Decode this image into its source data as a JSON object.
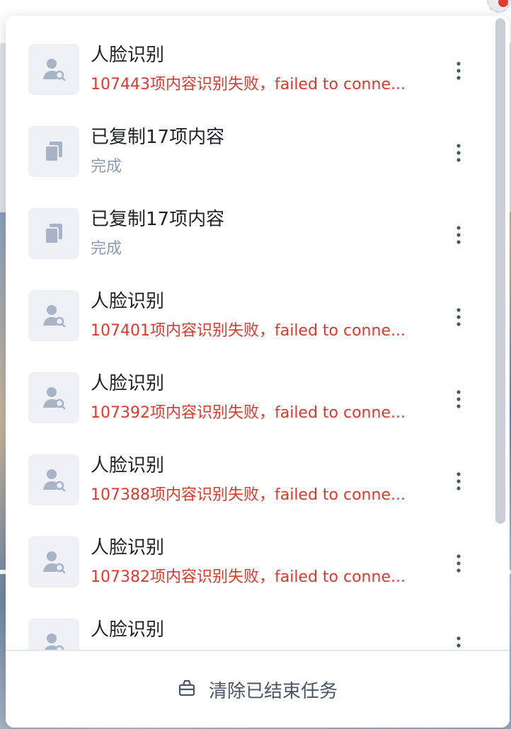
{
  "tasks": [
    {
      "type": "face",
      "icon": "face-search-icon",
      "title": "人脸识别",
      "subtitle": "107443项内容识别失败，failed to conne...",
      "status": "error"
    },
    {
      "type": "copy",
      "icon": "copy-icon",
      "title": "已复制17项内容",
      "subtitle": "完成",
      "status": "done"
    },
    {
      "type": "copy",
      "icon": "copy-icon",
      "title": "已复制17项内容",
      "subtitle": "完成",
      "status": "done"
    },
    {
      "type": "face",
      "icon": "face-search-icon",
      "title": "人脸识别",
      "subtitle": "107401项内容识别失败，failed to conne...",
      "status": "error"
    },
    {
      "type": "face",
      "icon": "face-search-icon",
      "title": "人脸识别",
      "subtitle": "107392项内容识别失败，failed to conne...",
      "status": "error"
    },
    {
      "type": "face",
      "icon": "face-search-icon",
      "title": "人脸识别",
      "subtitle": "107388项内容识别失败，failed to conne...",
      "status": "error"
    },
    {
      "type": "face",
      "icon": "face-search-icon",
      "title": "人脸识别",
      "subtitle": "107382项内容识别失败，failed to conne...",
      "status": "error"
    },
    {
      "type": "face",
      "icon": "face-search-icon",
      "title": "人脸识别",
      "subtitle": "",
      "status": "error"
    }
  ],
  "footer": {
    "clear_label": "清除已结束任务",
    "clear_icon": "basket-icon"
  },
  "colors": {
    "error": "#d93a2e",
    "done": "#8f9bb3",
    "icon_bg": "#eef0f5",
    "icon_fg": "#a9b3c6"
  }
}
